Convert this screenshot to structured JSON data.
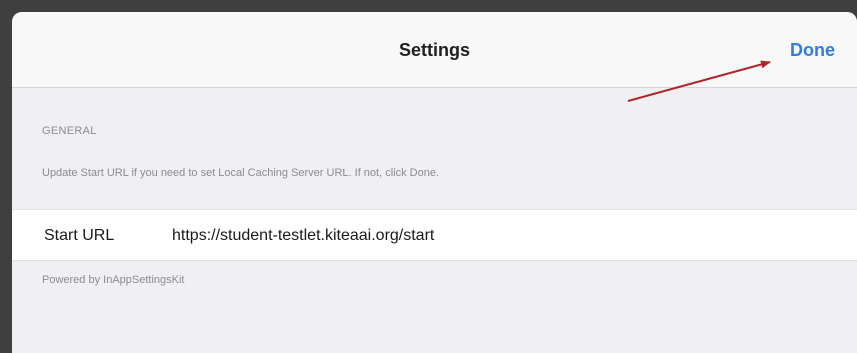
{
  "navbar": {
    "title": "Settings",
    "done_label": "Done"
  },
  "section": {
    "header": "GENERAL",
    "footer_text": "Update Start URL if you need to set Local Caching Server URL. If not, click Done."
  },
  "row": {
    "label": "Start URL",
    "value": "https://student-testlet.kiteaai.org/start"
  },
  "powered_by": "Powered by InAppSettingsKit",
  "colors": {
    "accent": "#2f7de1",
    "annotation_arrow": "#b0252b",
    "frame": "#3f3f3f"
  }
}
